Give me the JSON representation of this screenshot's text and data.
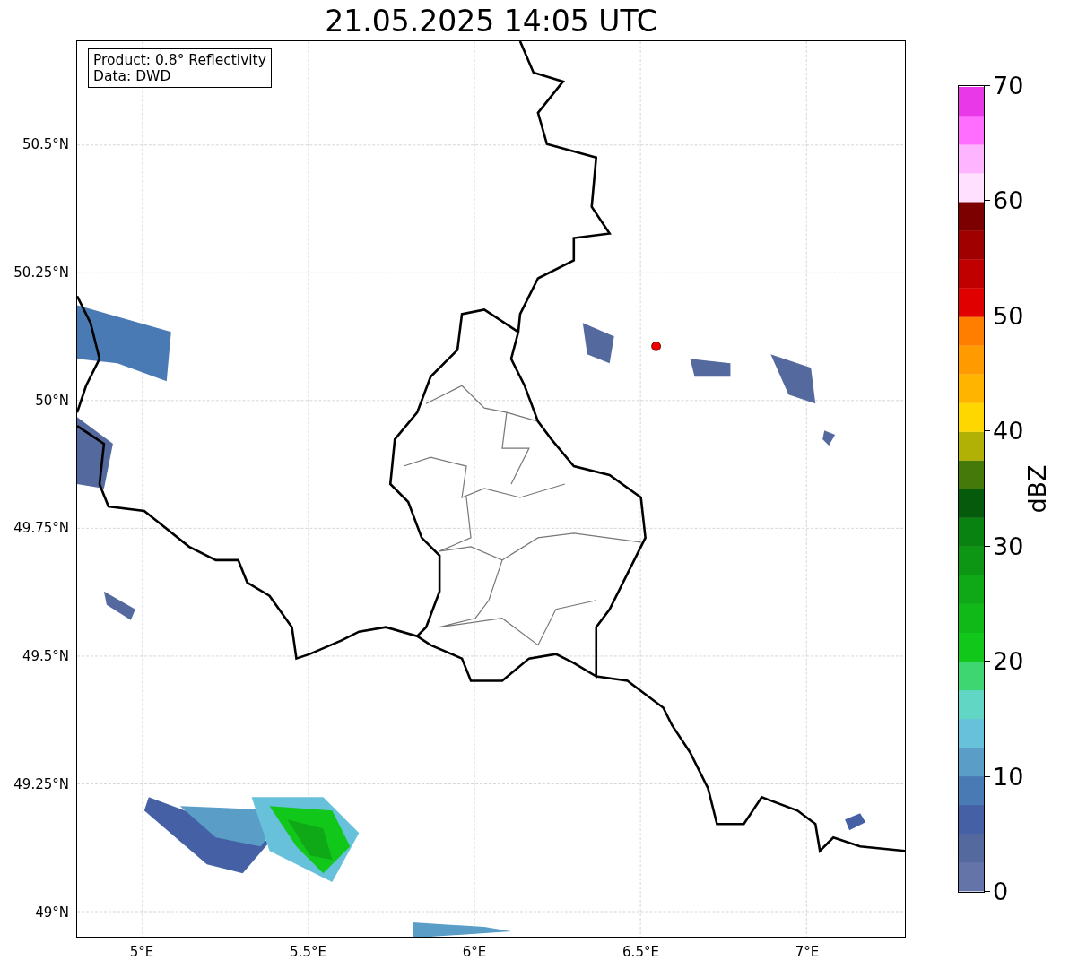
{
  "title": "21.05.2025 14:05 UTC",
  "info_box": [
    "Product: 0.8° Reflectivity",
    "Data: DWD"
  ],
  "x_ticks": [
    "5°E",
    "5.5°E",
    "6°E",
    "6.5°E",
    "7°E"
  ],
  "y_ticks": [
    "50.5°N",
    "50.25°N",
    "50°N",
    "49.75°N",
    "49.5°N",
    "49.25°N",
    "49°N"
  ],
  "colorbar": {
    "label": "dBZ",
    "ticks": [
      "70",
      "60",
      "50",
      "40",
      "30",
      "20",
      "10",
      "0"
    ],
    "bins": [
      {
        "color": "#6474a8"
      },
      {
        "color": "#54699e"
      },
      {
        "color": "#4560a4"
      },
      {
        "color": "#4a7ab3"
      },
      {
        "color": "#5a9ec8"
      },
      {
        "color": "#67c1db"
      },
      {
        "color": "#62d6c4"
      },
      {
        "color": "#3dd670"
      },
      {
        "color": "#11c81a"
      },
      {
        "color": "#10b818"
      },
      {
        "color": "#0fa816"
      },
      {
        "color": "#0d9614"
      },
      {
        "color": "#0a8212"
      },
      {
        "color": "#065a0c"
      },
      {
        "color": "#457a0a"
      },
      {
        "color": "#b0b005"
      },
      {
        "color": "#ffd700"
      },
      {
        "color": "#ffb400"
      },
      {
        "color": "#ff9a00"
      },
      {
        "color": "#ff7e00"
      },
      {
        "color": "#e00000"
      },
      {
        "color": "#c00000"
      },
      {
        "color": "#a00000"
      },
      {
        "color": "#7d0000"
      },
      {
        "color": "#ffe0ff"
      },
      {
        "color": "#ffb4ff"
      },
      {
        "color": "#ff6eff"
      },
      {
        "color": "#e838e8"
      }
    ]
  }
}
